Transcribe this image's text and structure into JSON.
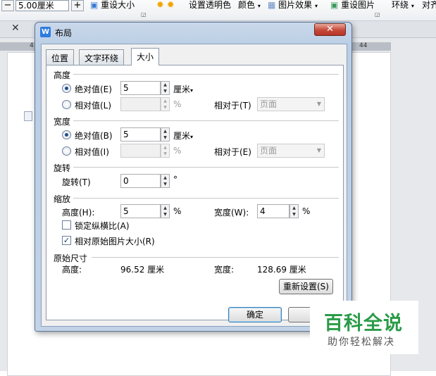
{
  "ribbon": {
    "size_value": "5.00厘米",
    "reset_size": "重设大小",
    "set_transparent": "设置透明色",
    "color": "颜色",
    "picture_effects": "图片效果",
    "reset_picture": "重设图片",
    "wrap": "环绕",
    "align": "对齐"
  },
  "ruler": {
    "left_num": "4",
    "right_num": "44"
  },
  "dialog": {
    "title": "布局",
    "tabs": [
      "位置",
      "文字环绕",
      "大小"
    ],
    "active_tab": "大小",
    "height_section": {
      "title": "高度",
      "absolute_label": "绝对值(E)",
      "absolute_value": "5",
      "unit": "厘米",
      "relative_label": "相对值(L)",
      "relative_value": "",
      "percent": "%",
      "relative_to_label": "相对于(T)",
      "relative_to_value": "页面",
      "absolute_selected": true
    },
    "width_section": {
      "title": "宽度",
      "absolute_label": "绝对值(B)",
      "absolute_value": "5",
      "unit": "厘米",
      "relative_label": "相对值(I)",
      "relative_value": "",
      "percent": "%",
      "relative_to_label": "相对于(E)",
      "relative_to_value": "页面",
      "absolute_selected": true
    },
    "rotate_section": {
      "title": "旋转",
      "label": "旋转(T)",
      "value": "0",
      "degree": "°"
    },
    "scale_section": {
      "title": "缩放",
      "height_label": "高度(H):",
      "height_value": "5",
      "width_label": "宽度(W):",
      "width_value": "4",
      "percent": "%",
      "lock_aspect": "锁定纵横比(A)",
      "lock_aspect_checked": false,
      "relative_original": "相对原始图片大小(R)",
      "relative_original_checked": true
    },
    "original_section": {
      "title": "原始尺寸",
      "height_label": "高度:",
      "height_value": "96.52 厘米",
      "width_label": "宽度:",
      "width_value": "128.69 厘米",
      "reset_button": "重新设置(S)"
    },
    "ok_button": "确定",
    "cancel_button": "取"
  },
  "watermark": {
    "title": "百科全说",
    "subtitle": "助你轻松解决"
  },
  "colors": {
    "accent": "#2f7ce0",
    "close": "#c6493a",
    "watermark": "#2a9b48"
  }
}
